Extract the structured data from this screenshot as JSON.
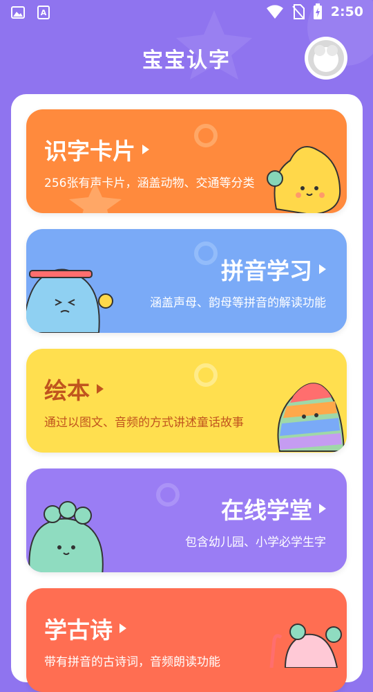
{
  "status_bar": {
    "time": "2:50",
    "icons": [
      "image-icon",
      "text-icon",
      "wifi-icon",
      "no-sim-icon",
      "battery-charging-icon"
    ]
  },
  "header": {
    "title": "宝宝认字",
    "avatar_icon": "avatar-placeholder-icon"
  },
  "cards": [
    {
      "title": "识字卡片",
      "desc": "256张有声卡片，涵盖动物、交通等分类",
      "color": "#ff8a3d",
      "title_color": "#ffffff",
      "desc_color": "#fff3e6",
      "mascot": "yellow-monster-icon"
    },
    {
      "title": "拼音学习",
      "desc": "涵盖声母、韵母等拼音的解读功能",
      "color": "#7aaaf7",
      "title_color": "#ffffff",
      "desc_color": "#ffffff",
      "mascot": "blue-monster-icon"
    },
    {
      "title": "绘本",
      "desc": "通过以图文、音频的方式讲述童话故事",
      "color": "#ffdf4f",
      "title_color": "#c0541e",
      "desc_color": "#c0541e",
      "mascot": "rainbow-monster-icon"
    },
    {
      "title": "在线学堂",
      "desc": "包含幼儿园、小学必学生字",
      "color": "#9a7df4",
      "title_color": "#ffffff",
      "desc_color": "#ffffff",
      "mascot": "green-monster-icon"
    },
    {
      "title": "学古诗",
      "desc": "带有拼音的古诗词，音频朗读功能",
      "color": "#ff6e52",
      "title_color": "#ffffff",
      "desc_color": "#ffffff",
      "mascot": "pink-monster-icon"
    }
  ]
}
